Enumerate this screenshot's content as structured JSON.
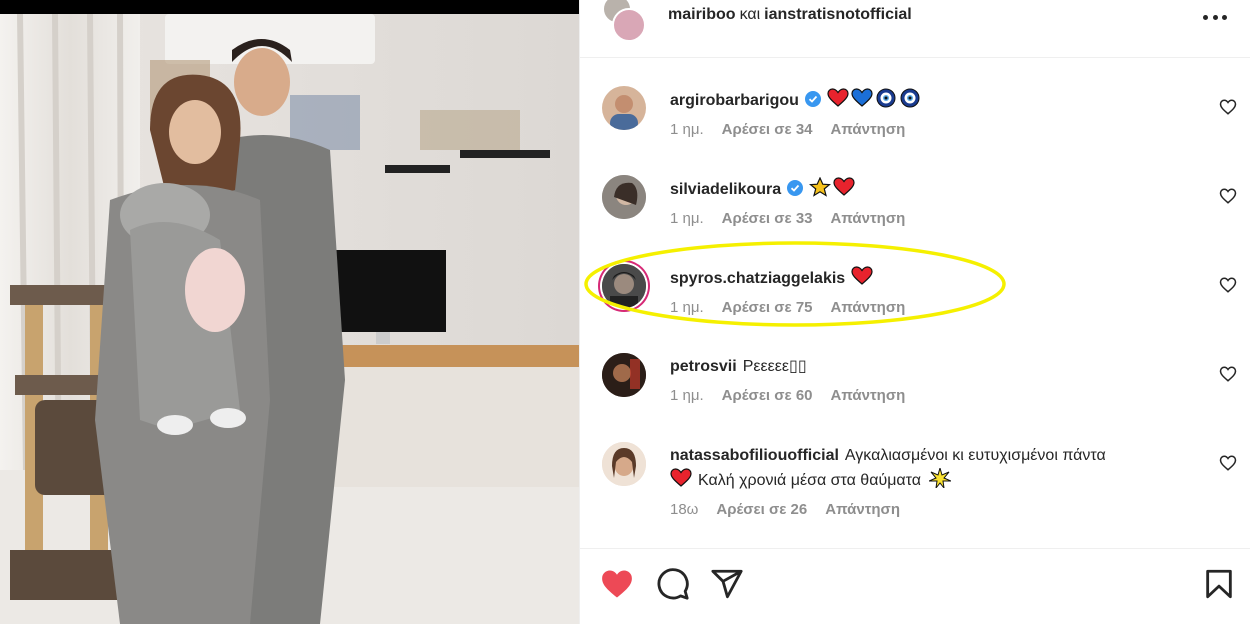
{
  "header": {
    "user1": "mairiboo",
    "conjunction": "και",
    "user2": "ianstratisnotofficial"
  },
  "comments": [
    {
      "username": "argirobarbarigou",
      "text": "",
      "verified": true,
      "time": "1 ημ.",
      "likes": "Αρέσει σε 34",
      "reply": "Απάντηση",
      "emojis": [
        "red-heart",
        "blue-heart",
        "nazar-amulet",
        "nazar-amulet"
      ]
    },
    {
      "username": "silviadelikoura",
      "text": "",
      "verified": true,
      "time": "1 ημ.",
      "likes": "Αρέσει σε 33",
      "reply": "Απάντηση",
      "emojis": [
        "star",
        "red-heart"
      ]
    },
    {
      "username": "spyros.chatziaggelakis",
      "text": "",
      "verified": false,
      "time": "1 ημ.",
      "likes": "Αρέσει σε 75",
      "reply": "Απάντηση",
      "emojis": [
        "red-heart"
      ],
      "highlighted": true
    },
    {
      "username": "petrosvii",
      "text": "Ρεεεεε▯▯",
      "verified": false,
      "time": "1 ημ.",
      "likes": "Αρέσει σε 60",
      "reply": "Απάντηση",
      "emojis": []
    },
    {
      "username": "natassabofiliouofficial",
      "text": "Αγκαλιασμένοι κι ευτυχισμένοι πάντα",
      "text2": "Καλή χρονιά μέσα στα θαύματα",
      "verified": false,
      "time": "18ω",
      "likes": "Αρέσει σε 26",
      "reply": "Απάντηση",
      "emojis": [
        "red-heart",
        "sparkle"
      ]
    }
  ],
  "icons": {
    "like": "heart-filled-icon",
    "comment": "comment-icon",
    "share": "share-icon",
    "save": "bookmark-icon",
    "more": "more-options-icon"
  },
  "colors": {
    "like_red": "#ed4956",
    "verified_blue": "#3897f0",
    "highlight_yellow": "#f5f000",
    "meta_gray": "#8e8e8e"
  }
}
